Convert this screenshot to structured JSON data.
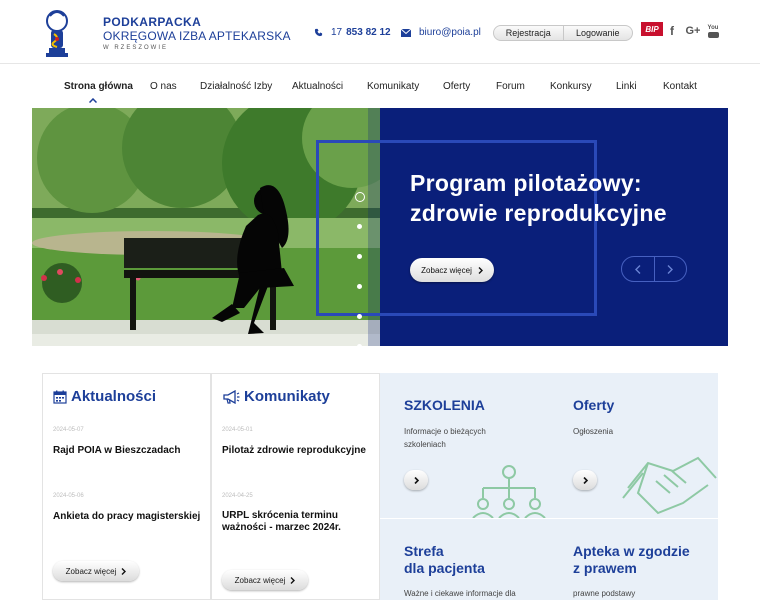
{
  "header": {
    "logo": {
      "line1": "PODKARPACKA",
      "line2": "OKRĘGOWA IZBA APTEKARSKA",
      "line3": "W RZESZOWIE"
    },
    "phone": {
      "prefix": "17",
      "number": "853 82 12",
      "icon": "phone-icon"
    },
    "email": {
      "value": "biuro@poia.pl",
      "icon": "envelope-icon"
    },
    "auth": {
      "register": "Rejestracja",
      "login": "Logowanie"
    },
    "social": {
      "bip": "BIP",
      "facebook": "f",
      "googleplus": "G+",
      "youtube": "You"
    }
  },
  "nav": {
    "items": [
      {
        "label": "Strona główna",
        "active": true
      },
      {
        "label": "O nas"
      },
      {
        "label": "Działalność Izby"
      },
      {
        "label": "Aktualności"
      },
      {
        "label": "Komunikaty"
      },
      {
        "label": "Oferty"
      },
      {
        "label": "Forum"
      },
      {
        "label": "Konkursy"
      },
      {
        "label": "Linki"
      },
      {
        "label": "Kontakt"
      }
    ]
  },
  "hero": {
    "title_line1": "Program pilotażowy:",
    "title_line2": "zdrowie reprodukcyjne",
    "button": "Zobacz więcej",
    "slides": 6,
    "current_slide": 1,
    "colors": {
      "background": "#0a1f7a",
      "frame": "#2a49b8"
    }
  },
  "news": {
    "heading": "Aktualności",
    "items": [
      {
        "date": "2024-05-07",
        "title": "Rajd POIA w Bieszczadach"
      },
      {
        "date": "2024-05-06",
        "title": "Ankieta do pracy magisterskiej"
      }
    ],
    "button": "Zobacz więcej"
  },
  "announcements": {
    "heading": "Komunikaty",
    "items": [
      {
        "date": "2024-05-01",
        "title": "Pilotaż zdrowie reprodukcyjne"
      },
      {
        "date": "2024-04-25",
        "title": "URPL skrócenia terminu ważności - marzec 2024r."
      }
    ],
    "button": "Zobacz więcej"
  },
  "tiles": {
    "training": {
      "title": "SZKOLENIA",
      "desc": "Informacje o bieżących szkoleniach"
    },
    "offers": {
      "title": "Oferty",
      "desc": "Ogłoszenia"
    },
    "patient": {
      "title_line1": "Strefa",
      "title_line2": "dla pacjenta",
      "desc": "Ważne i ciekawe informacje dla"
    },
    "law": {
      "title_line1": "Apteka w zgodzie",
      "title_line2": "z prawem",
      "desc": "prawne podstawy"
    }
  },
  "colors": {
    "brand": "#1d3f99",
    "tile_bg": "#e9f0f8",
    "art_green": "#8ec9a4"
  }
}
